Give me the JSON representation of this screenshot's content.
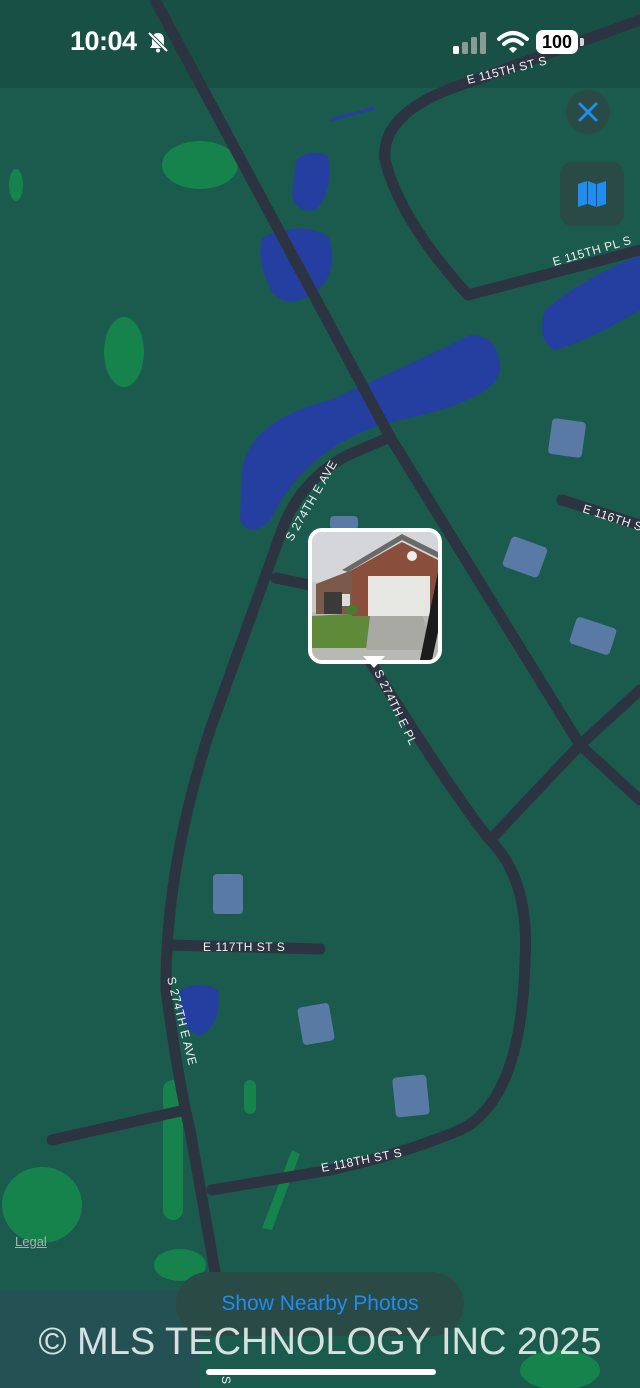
{
  "status_bar": {
    "time": "10:04",
    "battery": "100",
    "icons": [
      "bell-slash-icon",
      "cellular-signal-icon",
      "wifi-icon",
      "battery-icon"
    ]
  },
  "controls": {
    "close_icon": "close-icon",
    "map_mode_icon": "map-icon",
    "legal": "Legal",
    "show_nearby": "Show Nearby Photos"
  },
  "map": {
    "roads": {
      "top": "E 115TH ST S",
      "e115th_pl": "E 115TH PL S",
      "s274th_ave_north": "S 274TH E AVE",
      "e116th": "E 116TH S",
      "s274th_pl": "S 274TH E PL",
      "e117th": "E 117TH ST S",
      "s274th_ave_south": "S 274TH E AVE",
      "e118th": "E 118TH ST S",
      "bottom_fragment": "S"
    },
    "pin": {
      "type": "photo",
      "subject": "house-photo"
    }
  },
  "watermark": "© MLS TECHNOLOGY INC 2025",
  "colors": {
    "map_background": "#1b5b4e",
    "road": "#2c3442",
    "water": "#243fa0",
    "park": "#17834c",
    "building": "#5a7aa6",
    "accent": "#1f8cf0"
  }
}
